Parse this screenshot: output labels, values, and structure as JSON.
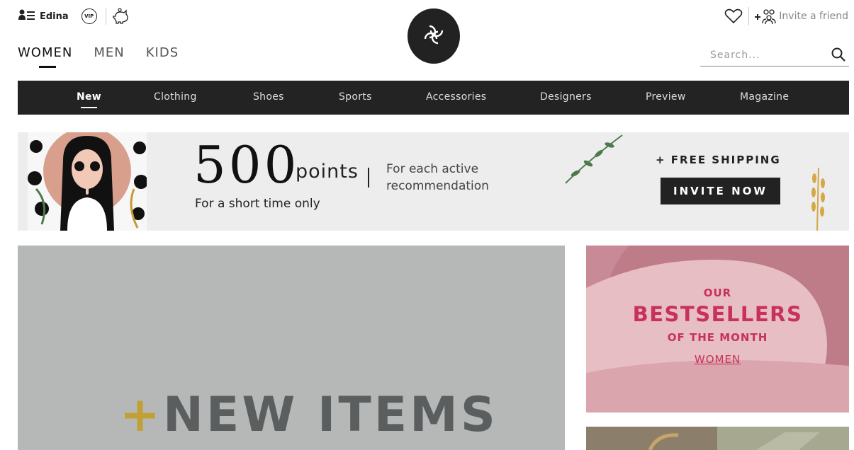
{
  "header": {
    "user_name": "Edina",
    "vip_label": "VIP",
    "invite_label": "Invite a friend",
    "search_placeholder": "Search..."
  },
  "gender_tabs": [
    {
      "label": "WOMEN",
      "active": true
    },
    {
      "label": "MEN",
      "active": false
    },
    {
      "label": "KIDS",
      "active": false
    }
  ],
  "categories": [
    {
      "label": "New",
      "active": true
    },
    {
      "label": "Clothing"
    },
    {
      "label": "Shoes"
    },
    {
      "label": "Sports"
    },
    {
      "label": "Accessories"
    },
    {
      "label": "Designers"
    },
    {
      "label": "Preview"
    },
    {
      "label": "Magazine"
    }
  ],
  "promo": {
    "big_number": "500",
    "points_label": "points",
    "description": "For each active recommendation",
    "short_time": "For a short time only",
    "free_shipping": "+ FREE SHIPPING",
    "cta": "INVITE NOW"
  },
  "hero": {
    "plus": "+",
    "title": "NEW ITEMS"
  },
  "bestsellers": {
    "our": "OUR",
    "title": "BESTSELLERS",
    "month": "OF THE MONTH",
    "link": "WOMEN"
  },
  "colors": {
    "nav_bg": "#232323",
    "promo_bg": "#ededed",
    "hero_bg": "#b5b8b7",
    "hero_plus": "#c2a035",
    "bestseller_pink": "#c8315a",
    "bestseller_bg": "#dba5ae"
  },
  "icons": [
    "account-menu-icon",
    "vip-icon",
    "piggy-bank-icon",
    "logo-mark-icon",
    "heart-icon",
    "invite-friends-icon",
    "search-icon"
  ]
}
